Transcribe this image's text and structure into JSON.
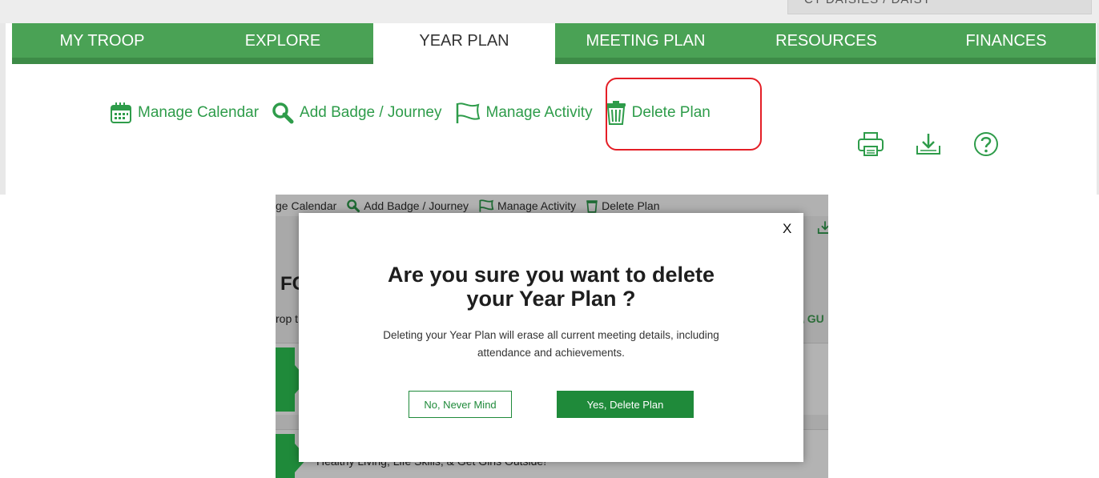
{
  "header": {
    "account_selector": "CT DAISIES / DAISY"
  },
  "nav": {
    "tabs": [
      {
        "label": "MY TROOP",
        "active": false
      },
      {
        "label": "EXPLORE",
        "active": false
      },
      {
        "label": "YEAR PLAN",
        "active": true
      },
      {
        "label": "MEETING PLAN",
        "active": false
      },
      {
        "label": "RESOURCES",
        "active": false
      },
      {
        "label": "FINANCES",
        "active": false
      }
    ]
  },
  "actions": {
    "manage_calendar": "Manage Calendar",
    "add_badge": "Add Badge / Journey",
    "manage_activity": "Manage Activity",
    "delete_plan": "Delete Plan"
  },
  "background": {
    "bar": {
      "manage_calendar": "ge Calendar",
      "add_badge": "Add Badge / Journey",
      "manage_activity": "Manage Activity",
      "delete_plan": "Delete Plan"
    },
    "heading": "FC",
    "subtext": "rop t",
    "guide": "\\ GU",
    "row2_text": "Healthy Living, Life Skills, & Get Girls Outside!"
  },
  "modal": {
    "close": "X",
    "title_line1": "Are you sure you want to delete",
    "title_line2": "your Year Plan ?",
    "body": "Deleting your Year Plan will erase all current meeting details, including attendance and achievements.",
    "cancel": "No, Never Mind",
    "confirm": "Yes, Delete Plan"
  },
  "colors": {
    "nav_green": "#4aa255",
    "action_green": "#2e9c4a",
    "button_green": "#1f8a3a",
    "highlight_red": "#e41e26"
  },
  "icons": {
    "calendar": "calendar-icon",
    "search": "search-icon",
    "flag": "flag-icon",
    "trash": "trash-icon",
    "print": "print-icon",
    "download": "download-icon",
    "help": "help-icon"
  }
}
